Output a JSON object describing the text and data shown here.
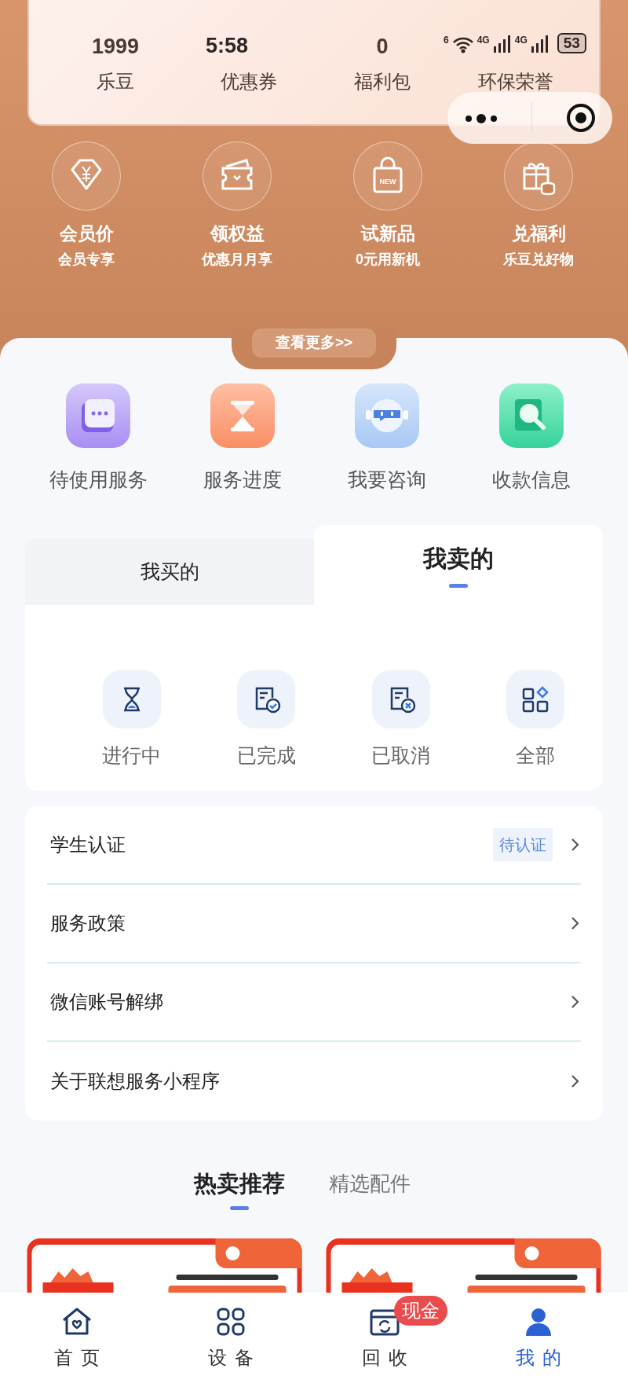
{
  "status_bar": {
    "time": "5:58",
    "wifi_label": "6",
    "network_1": "4G",
    "network_2": "4G",
    "battery": "53"
  },
  "stats": [
    {
      "value": "1999",
      "label": "乐豆"
    },
    {
      "label": "优惠券"
    },
    {
      "value": "0",
      "label": "福利包"
    },
    {
      "label": "环保荣誉"
    }
  ],
  "benefits": [
    {
      "kind": "diamond",
      "title": "会员价",
      "subtitle": "会员专享"
    },
    {
      "kind": "ticket",
      "title": "领权益",
      "subtitle": "优惠月月享"
    },
    {
      "kind": "bag",
      "title": "试新品",
      "subtitle": "0元用新机",
      "icon_text": "NEW"
    },
    {
      "kind": "gift",
      "title": "兑福利",
      "subtitle": "乐豆兑好物"
    }
  ],
  "more_link": "查看更多>>",
  "services": [
    {
      "kind": "chat",
      "label": "待使用服务"
    },
    {
      "kind": "hourglass",
      "label": "服务进度"
    },
    {
      "kind": "robot",
      "label": "我要咨询"
    },
    {
      "kind": "search",
      "label": "收款信息"
    }
  ],
  "order_tabs": [
    {
      "label": "我买的",
      "selected": false
    },
    {
      "label": "我卖的",
      "selected": true
    }
  ],
  "order_filters": [
    {
      "kind": "hourglass",
      "label": "进行中"
    },
    {
      "kind": "done",
      "label": "已完成"
    },
    {
      "kind": "cancel",
      "label": "已取消"
    },
    {
      "kind": "grid",
      "label": "全部"
    }
  ],
  "settings": [
    {
      "label": "学生认证",
      "badge": "待认证"
    },
    {
      "label": "服务政策"
    },
    {
      "label": "微信账号解绑"
    },
    {
      "label": "关于联想服务小程序"
    }
  ],
  "product_tabs": [
    {
      "label": "热卖推荐",
      "selected": true
    },
    {
      "label": "精选配件",
      "selected": false
    }
  ],
  "nav": [
    {
      "kind": "home",
      "label": "首页",
      "selected": false
    },
    {
      "kind": "grid",
      "label": "设备",
      "selected": false
    },
    {
      "kind": "recycle",
      "label": "回收",
      "selected": false,
      "badge": "现金"
    },
    {
      "kind": "person",
      "label": "我的",
      "selected": true
    }
  ]
}
